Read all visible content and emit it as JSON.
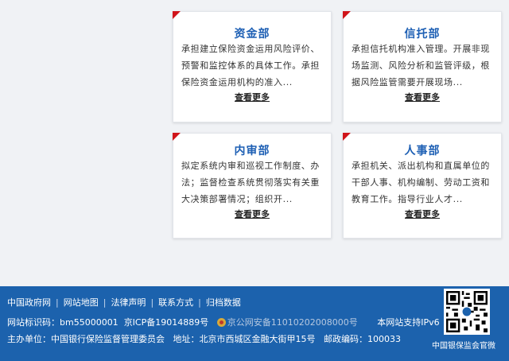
{
  "departments": [
    {
      "title": "资金部",
      "desc": "承担建立保险资金运用风险评价、预警和监控体系的具体工作。承担保险资金运用机构的准入...",
      "more": "查看更多"
    },
    {
      "title": "信托部",
      "desc": "承担信托机构准入管理。开展非现场监测、风险分析和监管评级，根据风险监管需要开展现场...",
      "more": "查看更多"
    },
    {
      "title": "内审部",
      "desc": "拟定系统内审和巡视工作制度、办法；监督检查系统贯彻落实有关重大决策部署情况；组织开...",
      "more": "查看更多"
    },
    {
      "title": "人事部",
      "desc": "承担机关、派出机构和直属单位的干部人事、机构编制、劳动工资和教育工作。指导行业人才...",
      "more": "查看更多"
    }
  ],
  "footer": {
    "links": [
      "中国政府网",
      "网站地图",
      "法律声明",
      "联系方式",
      "归档数据"
    ],
    "site_code": "网站标识码：bm55000001",
    "icp": "京ICP备19014889号",
    "police": "京公网安备11010202008000号",
    "ipv6": "本网站支持IPv6",
    "host": "主办单位：中国银行保险监督管理委员会",
    "address": "地址：北京市西城区金融大街甲15号",
    "postcode": "邮政编码：100033",
    "qr_label": "中国银保监会官微"
  },
  "colors": {
    "accent_red": "#d0141a",
    "title_blue": "#1d5fb4",
    "footer_blue": "#1c62ad"
  }
}
